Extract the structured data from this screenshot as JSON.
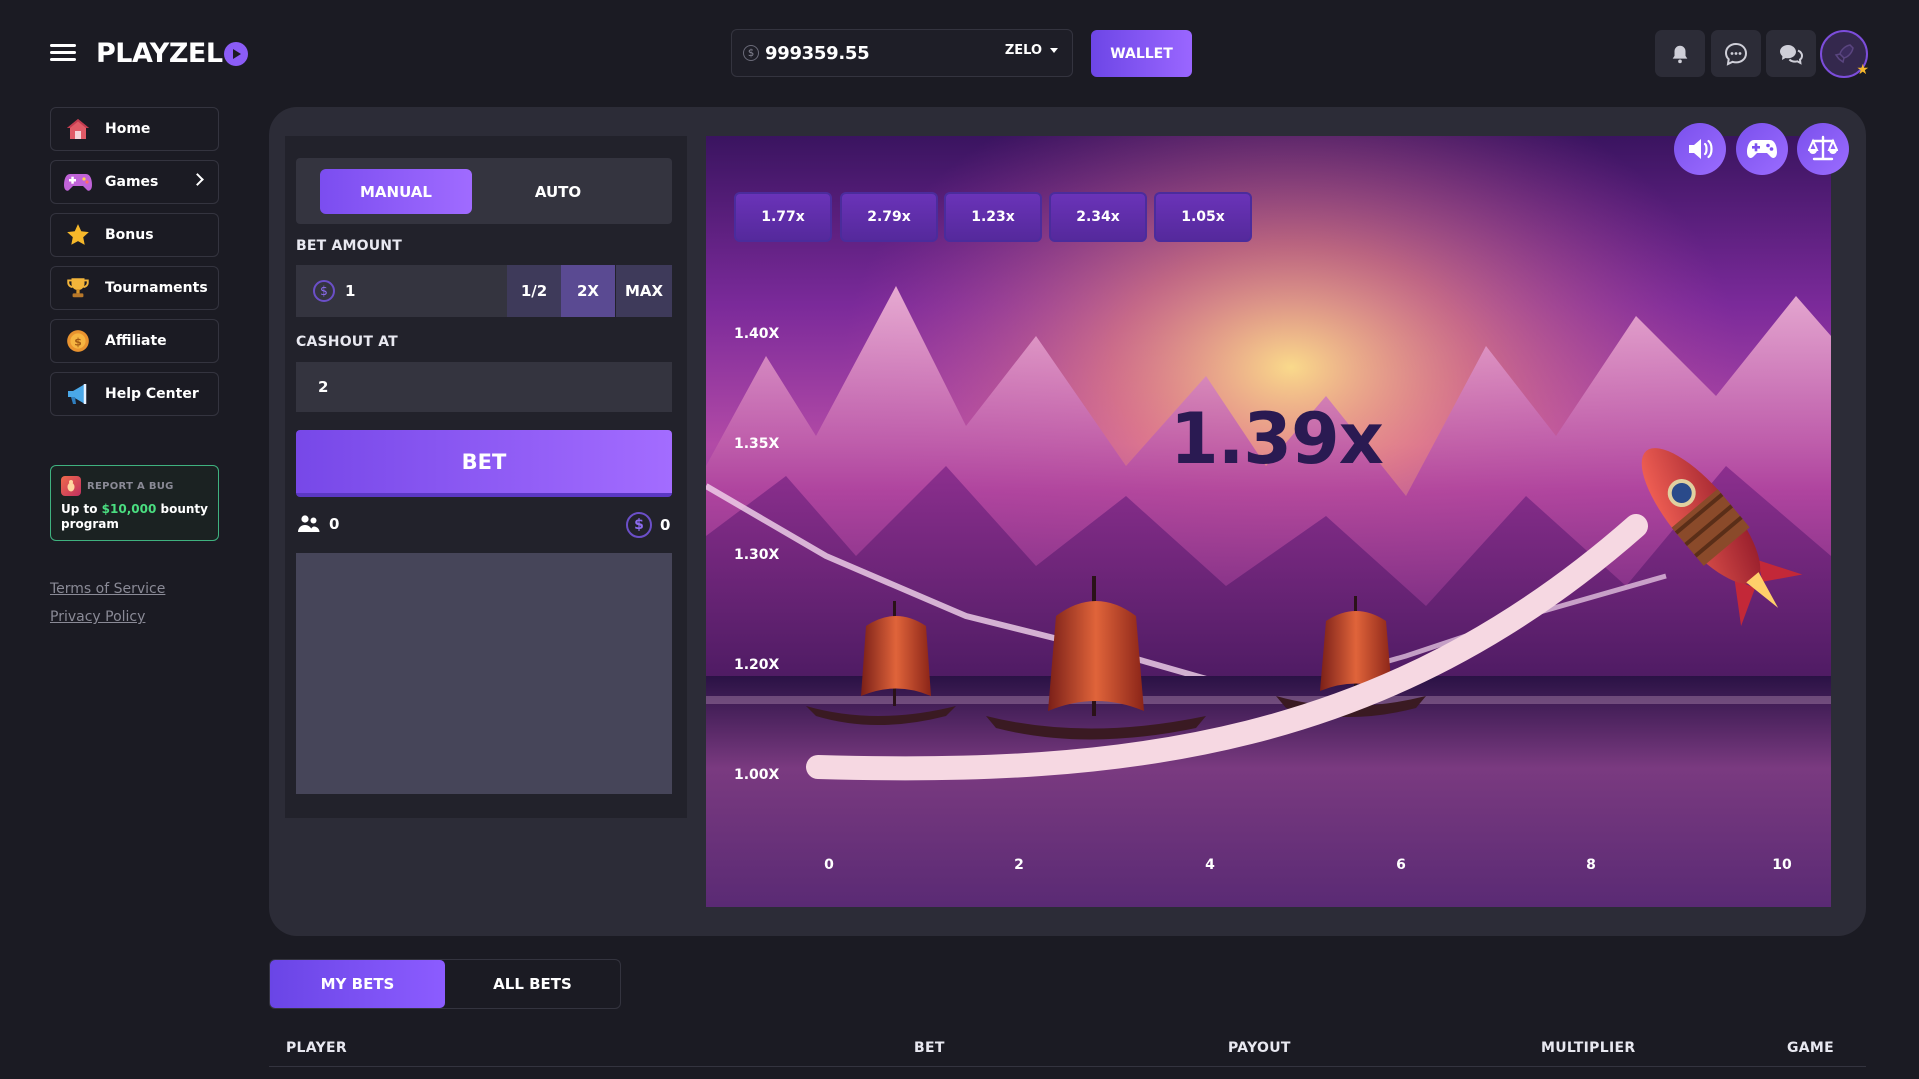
{
  "header": {
    "logo": "PLAYZEL",
    "balance": "999359.55",
    "coin_symbol": "$",
    "currency": "ZELO",
    "wallet_label": "WALLET",
    "icons": [
      "bell-icon",
      "chat-icon",
      "community-icon"
    ]
  },
  "sidebar": {
    "items": [
      {
        "label": "Home",
        "icon": "home-icon"
      },
      {
        "label": "Games",
        "icon": "gamepad-icon"
      },
      {
        "label": "Bonus",
        "icon": "star-icon"
      },
      {
        "label": "Tournaments",
        "icon": "trophy-icon"
      },
      {
        "label": "Affiliate",
        "icon": "coin-icon"
      },
      {
        "label": "Help Center",
        "icon": "megaphone-icon"
      }
    ],
    "bug_card": {
      "title": "REPORT A BUG",
      "text_prefix": "Up to ",
      "amount": "$10,000",
      "text_suffix": " bounty program"
    },
    "links": [
      "Terms of Service",
      "Privacy Policy"
    ]
  },
  "controls": {
    "tab_manual": "MANUAL",
    "tab_auto": "AUTO",
    "bet_amount_label": "BET AMOUNT",
    "bet_amount_value": "1",
    "quick": [
      "1/2",
      "2X",
      "MAX"
    ],
    "cashout_label": "CASHOUT AT",
    "cashout_value": "2",
    "bet_button": "BET",
    "players_count": "0",
    "total_bet": "0"
  },
  "game": {
    "history": [
      "1.77x",
      "2.79x",
      "1.23x",
      "2.34x",
      "1.05x"
    ],
    "multiplier": "1.39x",
    "y_labels": [
      "1.40X",
      "1.35X",
      "1.30X",
      "1.20X",
      "1.00X"
    ],
    "x_labels": [
      "0",
      "2",
      "4",
      "6",
      "8",
      "10"
    ],
    "buttons": [
      "sound-icon",
      "gamepad-icon",
      "fairness-scale-icon"
    ]
  },
  "bets": {
    "tab_my": "MY BETS",
    "tab_all": "ALL BETS",
    "columns": [
      "PLAYER",
      "BET",
      "PAYOUT",
      "MULTIPLIER",
      "GAME"
    ]
  },
  "colors": {
    "accent": "#8b5cf6",
    "background": "#1b1b23",
    "panel": "#2c2c37",
    "bounty_green": "#4ade80"
  }
}
